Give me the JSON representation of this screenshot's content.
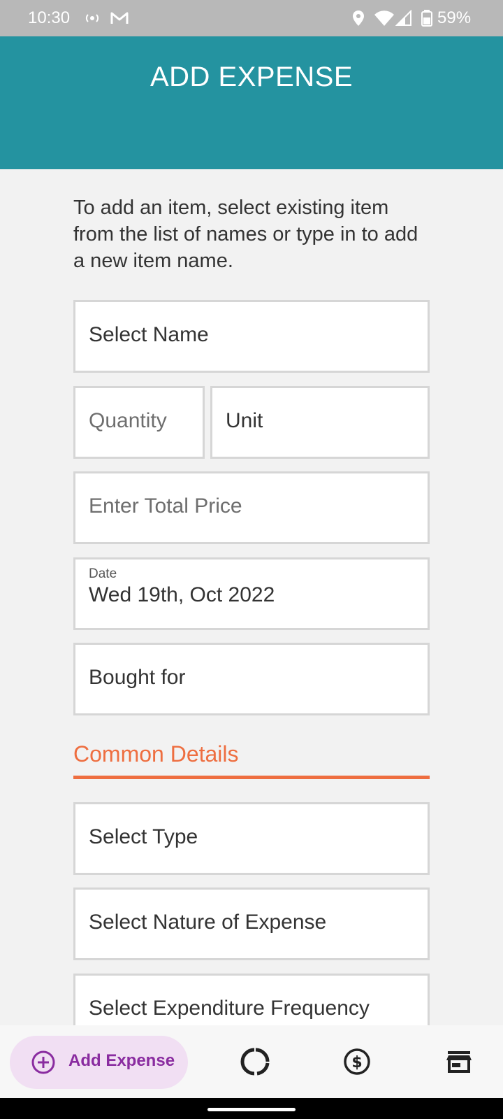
{
  "status_bar": {
    "time": "10:30",
    "battery": "59%",
    "icons": [
      "radio-icon",
      "gmail-icon",
      "location-icon",
      "wifi-icon",
      "signal-icon",
      "battery-icon"
    ]
  },
  "header": {
    "title": "ADD EXPENSE"
  },
  "intro_text": "To add an item, select existing item from the list of names or type in to add a new item name.",
  "form": {
    "name_value": "Select Name",
    "quantity_placeholder": "Quantity",
    "unit_value": "Unit",
    "total_price_placeholder": "Enter Total Price",
    "date_label": "Date",
    "date_value": "Wed 19th, Oct 2022",
    "bought_for_value": "Bought for"
  },
  "common_details": {
    "title": "Common Details",
    "type_value": "Select Type",
    "nature_value": "Select Nature of Expense",
    "frequency_value": "Select Expenditure Frequency"
  },
  "bottom_nav": {
    "add_label": "Add Expense",
    "items": [
      "add-circle-icon",
      "donut-chart-icon",
      "dollar-circle-icon",
      "store-icon"
    ]
  },
  "colors": {
    "header_bg": "#2493a0",
    "accent_orange": "#ee6e40",
    "nav_active_bg": "#f1dff3",
    "nav_active_fg": "#8a2ca0"
  }
}
